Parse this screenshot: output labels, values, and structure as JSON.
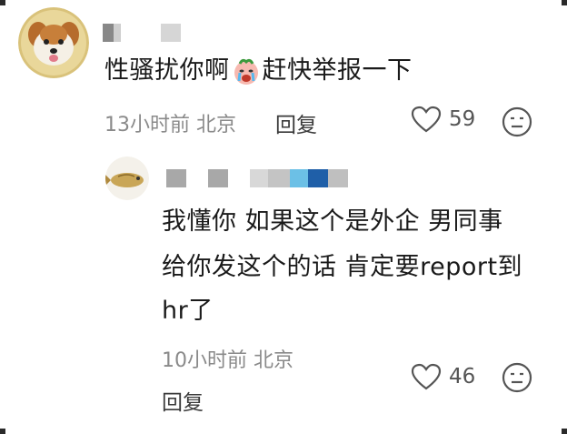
{
  "comments": [
    {
      "text_before": "性骚扰你啊",
      "text_after": "赶快举报一下",
      "emoji": "crying-face-emoji",
      "time_location": "13小时前 北京",
      "reply_label": "回复",
      "likes": "59"
    },
    {
      "lines": [
        "我懂你 如果这个是外企 男同事",
        "给你发这个的话 肯定要report到",
        "hr了"
      ],
      "time_location": "10小时前 北京",
      "reply_label": "回复",
      "likes": "46"
    }
  ],
  "colors": {
    "accent_blue": "#3aa3d8",
    "dark_blue": "#1f5fa8",
    "mid_blue": "#6cc0e6",
    "gray": "#8a8a8a"
  }
}
